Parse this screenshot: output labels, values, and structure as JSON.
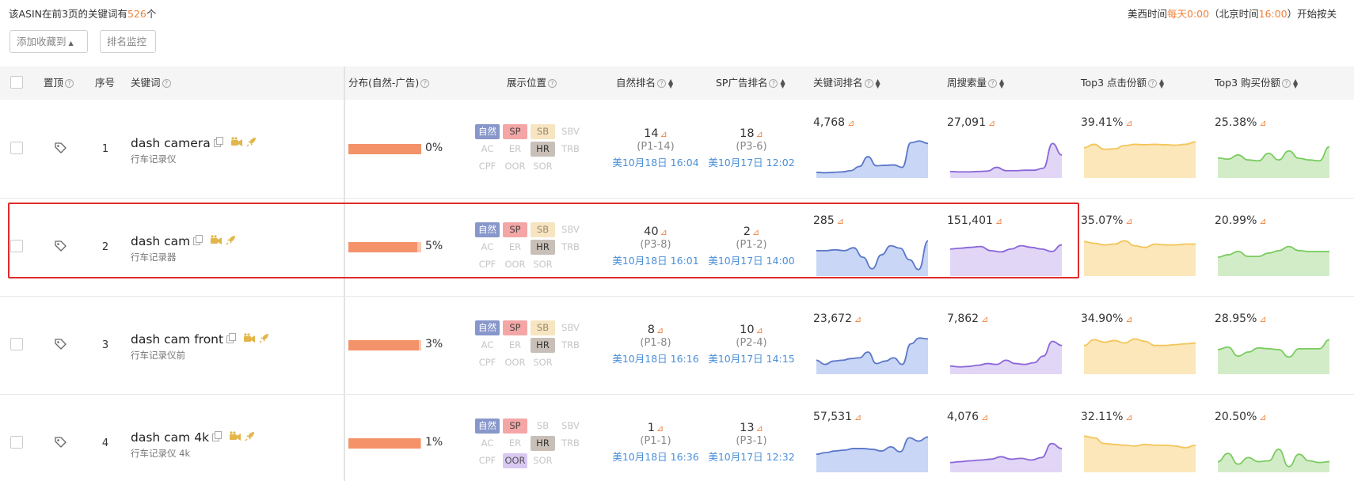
{
  "summary": {
    "prefix": "该ASIN在前3页的关键词有",
    "count": "526",
    "suffix": "个"
  },
  "notice": {
    "a": "美西时间",
    "b": "每天0:00",
    "c": "（北京时间",
    "d": "16:00",
    "e": "）开始按关"
  },
  "toolbar": {
    "collect_label": "添加收藏到",
    "monitor_label": "排名监控"
  },
  "columns": {
    "pin": "置顶",
    "seq": "序号",
    "keyword": "关键词",
    "distribution": "分布(自然-广告)",
    "position": "展示位置",
    "organic_rank": "自然排名",
    "sp_rank": "SP广告排名",
    "keyword_rank": "关键词排名",
    "weekly_volume": "周搜索量",
    "top3_click": "Top3 点击份额",
    "top3_purchase": "Top3 购买份额"
  },
  "position_labels": [
    "自然",
    "SP",
    "SB",
    "SBV",
    "AC",
    "ER",
    "HR",
    "TRB",
    "CPF",
    "OOR",
    "SOR"
  ],
  "colors": {
    "accent": "#f0833a",
    "link": "#4a8fd8",
    "highlight": "#e02b2b"
  },
  "rows": [
    {
      "idx": "1",
      "keyword": "dash camera",
      "keyword_cn": "行车记录仪",
      "distribution": 0,
      "dist_label": "0%",
      "positions": {
        "自然": "blue",
        "SP": "pink",
        "SB": "yellow",
        "HR": "gray"
      },
      "organic": {
        "value": "14",
        "page": "(P1-14)",
        "date": "美10月18日 16:04"
      },
      "sp": {
        "value": "18",
        "page": "(P3-6)",
        "date": "美10月17日 12:02"
      },
      "keyword_rank": "4,768",
      "weekly_volume": "27,091",
      "top3_click": "39.41%",
      "top3_purchase": "25.38%",
      "spark": {
        "rank": [
          0.1,
          0.09,
          0.1,
          0.11,
          0.14,
          0.24,
          0.48,
          0.26,
          0.27,
          0.28,
          0.22,
          0.82,
          0.86,
          0.8
        ],
        "volume": [
          0.12,
          0.11,
          0.11,
          0.12,
          0.13,
          0.22,
          0.14,
          0.14,
          0.15,
          0.15,
          0.2,
          0.8,
          0.52
        ],
        "click": [
          0.7,
          0.78,
          0.66,
          0.67,
          0.75,
          0.78,
          0.77,
          0.78,
          0.77,
          0.76,
          0.78,
          0.84
        ],
        "purchase": [
          0.45,
          0.42,
          0.52,
          0.4,
          0.38,
          0.56,
          0.4,
          0.62,
          0.44,
          0.4,
          0.38,
          0.72
        ]
      }
    },
    {
      "idx": "2",
      "keyword": "dash cam",
      "keyword_cn": "行车记录器",
      "distribution": 5,
      "dist_label": "5%",
      "positions": {
        "自然": "blue",
        "SP": "pink",
        "SB": "yellow",
        "HR": "gray"
      },
      "organic": {
        "value": "40",
        "page": "(P3-8)",
        "date": "美10月18日 16:01"
      },
      "sp": {
        "value": "2",
        "page": "(P1-2)",
        "date": "美10月17日 14:00"
      },
      "keyword_rank": "285",
      "weekly_volume": "151,401",
      "top3_click": "35.07%",
      "top3_purchase": "20.99%",
      "spark": {
        "rank": [
          0.58,
          0.58,
          0.6,
          0.58,
          0.65,
          0.42,
          0.14,
          0.48,
          0.7,
          0.64,
          0.36,
          0.12,
          0.82
        ],
        "volume": [
          0.62,
          0.64,
          0.66,
          0.68,
          0.58,
          0.55,
          0.62,
          0.7,
          0.66,
          0.62,
          0.56,
          0.72
        ],
        "click": [
          0.8,
          0.76,
          0.72,
          0.74,
          0.82,
          0.7,
          0.66,
          0.74,
          0.72,
          0.72,
          0.74,
          0.74
        ],
        "purchase": [
          0.42,
          0.48,
          0.56,
          0.44,
          0.44,
          0.52,
          0.58,
          0.68,
          0.58,
          0.56,
          0.56,
          0.56
        ]
      }
    },
    {
      "idx": "3",
      "keyword": "dash cam front",
      "keyword_cn": "行车记录仪前",
      "distribution": 3,
      "dist_label": "3%",
      "positions": {
        "自然": "blue",
        "SP": "pink",
        "SB": "yellow",
        "HR": "gray"
      },
      "organic": {
        "value": "8",
        "page": "(P1-8)",
        "date": "美10月18日 16:16"
      },
      "sp": {
        "value": "10",
        "page": "(P2-4)",
        "date": "美10月17日 14:15"
      },
      "keyword_rank": "23,672",
      "weekly_volume": "7,862",
      "top3_click": "34.90%",
      "top3_purchase": "28.95%",
      "spark": {
        "rank": [
          0.3,
          0.2,
          0.28,
          0.3,
          0.34,
          0.36,
          0.5,
          0.22,
          0.28,
          0.36,
          0.2,
          0.7,
          0.84,
          0.82
        ],
        "volume": [
          0.16,
          0.14,
          0.15,
          0.18,
          0.22,
          0.2,
          0.3,
          0.22,
          0.2,
          0.24,
          0.4,
          0.76,
          0.66
        ],
        "click": [
          0.66,
          0.8,
          0.74,
          0.78,
          0.72,
          0.82,
          0.76,
          0.66,
          0.66,
          0.68,
          0.7,
          0.72
        ],
        "purchase": [
          0.56,
          0.62,
          0.4,
          0.5,
          0.6,
          0.58,
          0.56,
          0.38,
          0.58,
          0.58,
          0.58,
          0.8
        ]
      }
    },
    {
      "idx": "4",
      "keyword": "dash cam 4k",
      "keyword_cn": "行车记录仪 4k",
      "distribution": 1,
      "dist_label": "1%",
      "positions": {
        "自然": "blue",
        "SP": "pink",
        "HR": "gray",
        "OOR": "purple"
      },
      "organic": {
        "value": "1",
        "page": "(P1-1)",
        "date": "美10月18日 16:36"
      },
      "sp": {
        "value": "13",
        "page": "(P3-1)",
        "date": "美10月17日 12:32"
      },
      "keyword_rank": "57,531",
      "weekly_volume": "4,076",
      "top3_click": "32.11%",
      "top3_purchase": "20.50%",
      "spark": {
        "rank": [
          0.4,
          0.44,
          0.48,
          0.5,
          0.54,
          0.54,
          0.52,
          0.48,
          0.58,
          0.46,
          0.8,
          0.72,
          0.82
        ],
        "volume": [
          0.2,
          0.22,
          0.24,
          0.26,
          0.28,
          0.34,
          0.28,
          0.3,
          0.26,
          0.32,
          0.66,
          0.54
        ],
        "click": [
          0.84,
          0.8,
          0.66,
          0.64,
          0.62,
          0.6,
          0.64,
          0.62,
          0.62,
          0.6,
          0.56,
          0.62
        ],
        "purchase": [
          0.22,
          0.42,
          0.16,
          0.32,
          0.22,
          0.24,
          0.52,
          0.1,
          0.4,
          0.24,
          0.2,
          0.22
        ]
      }
    }
  ]
}
